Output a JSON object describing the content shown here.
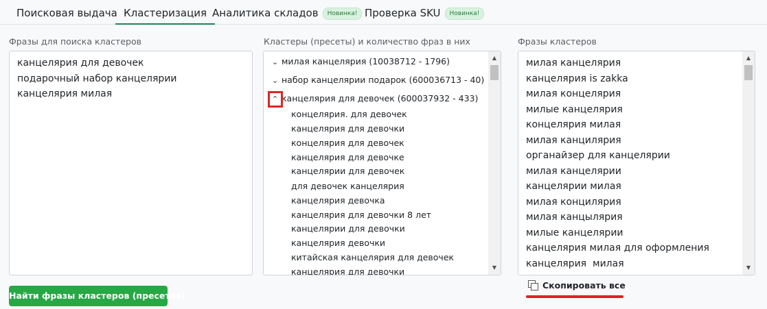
{
  "tabs": [
    {
      "label": "Поисковая выдача"
    },
    {
      "label": "Кластеризация"
    },
    {
      "label": "Аналитика складов",
      "badge": "Новинка!"
    },
    {
      "label": "Проверка SKU",
      "badge": "Новинка!"
    }
  ],
  "active_tab": "Кластеризация",
  "left": {
    "label": "Фразы для поиска кластеров",
    "lines": [
      "канцелярия для девочек",
      "подарочный набор канцелярии",
      "канцелярия милая"
    ],
    "button_label": "Найти фразы кластеров (пресетов)"
  },
  "middle": {
    "label": "Кластеры (пресеты) и количество фраз в них",
    "clusters": [
      {
        "label": "милая канцелярия (10038712 - 1796)",
        "expanded": false
      },
      {
        "label": "набор канцелярии подарок (600036713 - 40)",
        "expanded": false
      },
      {
        "label": "канцелярия для девочек (600037932 - 433)",
        "expanded": true
      }
    ],
    "phrases": [
      "концелярия. для девочек",
      "канцелярия для девочки",
      "концелярия для девочек",
      "канцелярия для девочке",
      "канцелярии для девочек",
      "для девочек канцелярия",
      "канцелярия девочка",
      "канцелярия для девочки 8 лет",
      "канцелярии для девочки",
      "канцелярия девочки",
      "китайская канцелярия для девочек",
      "канцелярия для девочки"
    ]
  },
  "right": {
    "label": "Фразы кластеров",
    "lines": [
      "милая канцелярия",
      "канцелярия is zakka",
      "милая концелярия",
      "милые канцелярия",
      "концелярия милая",
      "милая канцилярия",
      "органайзер для канцелярии",
      "милая канцелярии",
      "канцелярии милая",
      "милая концилярия",
      "милая канцылярия",
      "милые канцелярии",
      "канцелярия милая для оформления",
      "канцелярия  милая"
    ],
    "copy_label": "Скопировать все"
  },
  "icons": {
    "chevron_down": "chevron-down-icon",
    "chevron_up": "chevron-up-icon",
    "copy": "copy-icon"
  },
  "colors": {
    "accent_green": "#28a745",
    "badge_bg": "#d9f2df",
    "highlight_red": "#e02424"
  }
}
